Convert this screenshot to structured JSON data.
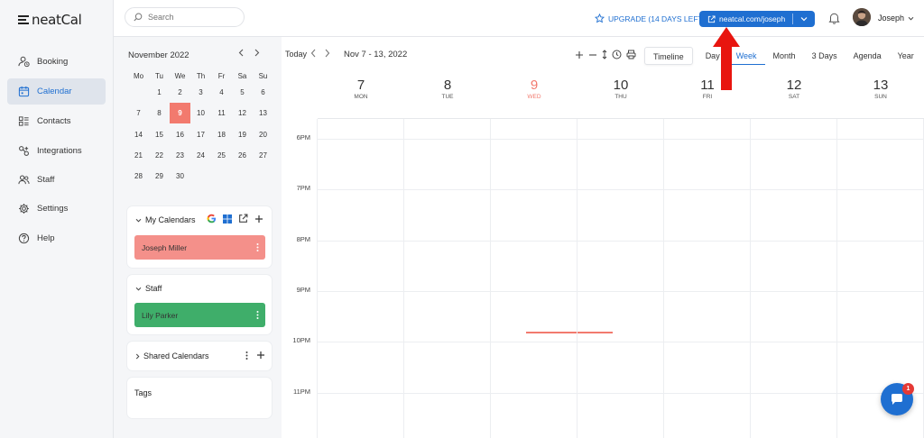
{
  "app": {
    "name": "neatCal"
  },
  "nav": {
    "items": [
      {
        "label": "Booking",
        "icon": "user-clock-icon",
        "active": false
      },
      {
        "label": "Calendar",
        "icon": "calendar-icon",
        "active": true
      },
      {
        "label": "Contacts",
        "icon": "contacts-icon",
        "active": false
      },
      {
        "label": "Integrations",
        "icon": "integrations-icon",
        "active": false
      },
      {
        "label": "Staff",
        "icon": "staff-icon",
        "active": false
      },
      {
        "label": "Settings",
        "icon": "gear-icon",
        "active": false
      },
      {
        "label": "Help",
        "icon": "help-icon",
        "active": false
      }
    ]
  },
  "topbar": {
    "search_placeholder": "Search",
    "upgrade_label": "UPGRADE (14 DAYS LEFT)",
    "link_label": "neatcal.com/joseph",
    "user_name": "Joseph"
  },
  "mini_calendar": {
    "month_label": "November 2022",
    "weekdays": [
      "Mo",
      "Tu",
      "We",
      "Th",
      "Fr",
      "Sa",
      "Su"
    ],
    "weeks": [
      [
        "",
        "1",
        "2",
        "3",
        "4",
        "5",
        "6"
      ],
      [
        "7",
        "8",
        "9",
        "10",
        "11",
        "12",
        "13"
      ],
      [
        "14",
        "15",
        "16",
        "17",
        "18",
        "19",
        "20"
      ],
      [
        "21",
        "22",
        "23",
        "24",
        "25",
        "26",
        "27"
      ],
      [
        "28",
        "29",
        "30",
        "",
        "",
        "",
        ""
      ]
    ],
    "today": "9"
  },
  "my_calendars": {
    "title": "My Calendars",
    "items": [
      {
        "label": "Joseph Miller",
        "color": "#f4908a"
      }
    ]
  },
  "staff": {
    "title": "Staff",
    "items": [
      {
        "label": "Lily Parker",
        "color": "#3fae6a"
      }
    ]
  },
  "shared": {
    "title": "Shared Calendars"
  },
  "tags": {
    "title": "Tags"
  },
  "toolbar": {
    "today_label": "Today",
    "range_label": "Nov 7 - 13, 2022",
    "views": [
      "Timeline",
      "Day",
      "Week",
      "Month",
      "3 Days",
      "Agenda",
      "Year"
    ],
    "selected_view": "Week"
  },
  "days": [
    {
      "num": "7",
      "dow": "MON"
    },
    {
      "num": "8",
      "dow": "TUE"
    },
    {
      "num": "9",
      "dow": "WED",
      "today": true
    },
    {
      "num": "10",
      "dow": "THU"
    },
    {
      "num": "11",
      "dow": "FRI"
    },
    {
      "num": "12",
      "dow": "SAT"
    },
    {
      "num": "13",
      "dow": "SUN"
    }
  ],
  "times": [
    "6PM",
    "7PM",
    "8PM",
    "9PM",
    "10PM",
    "11PM"
  ],
  "chat": {
    "badge": "1"
  },
  "colors": {
    "accent": "#1f6fd1",
    "today": "#f27a6e",
    "arrow": "#e8150f"
  }
}
